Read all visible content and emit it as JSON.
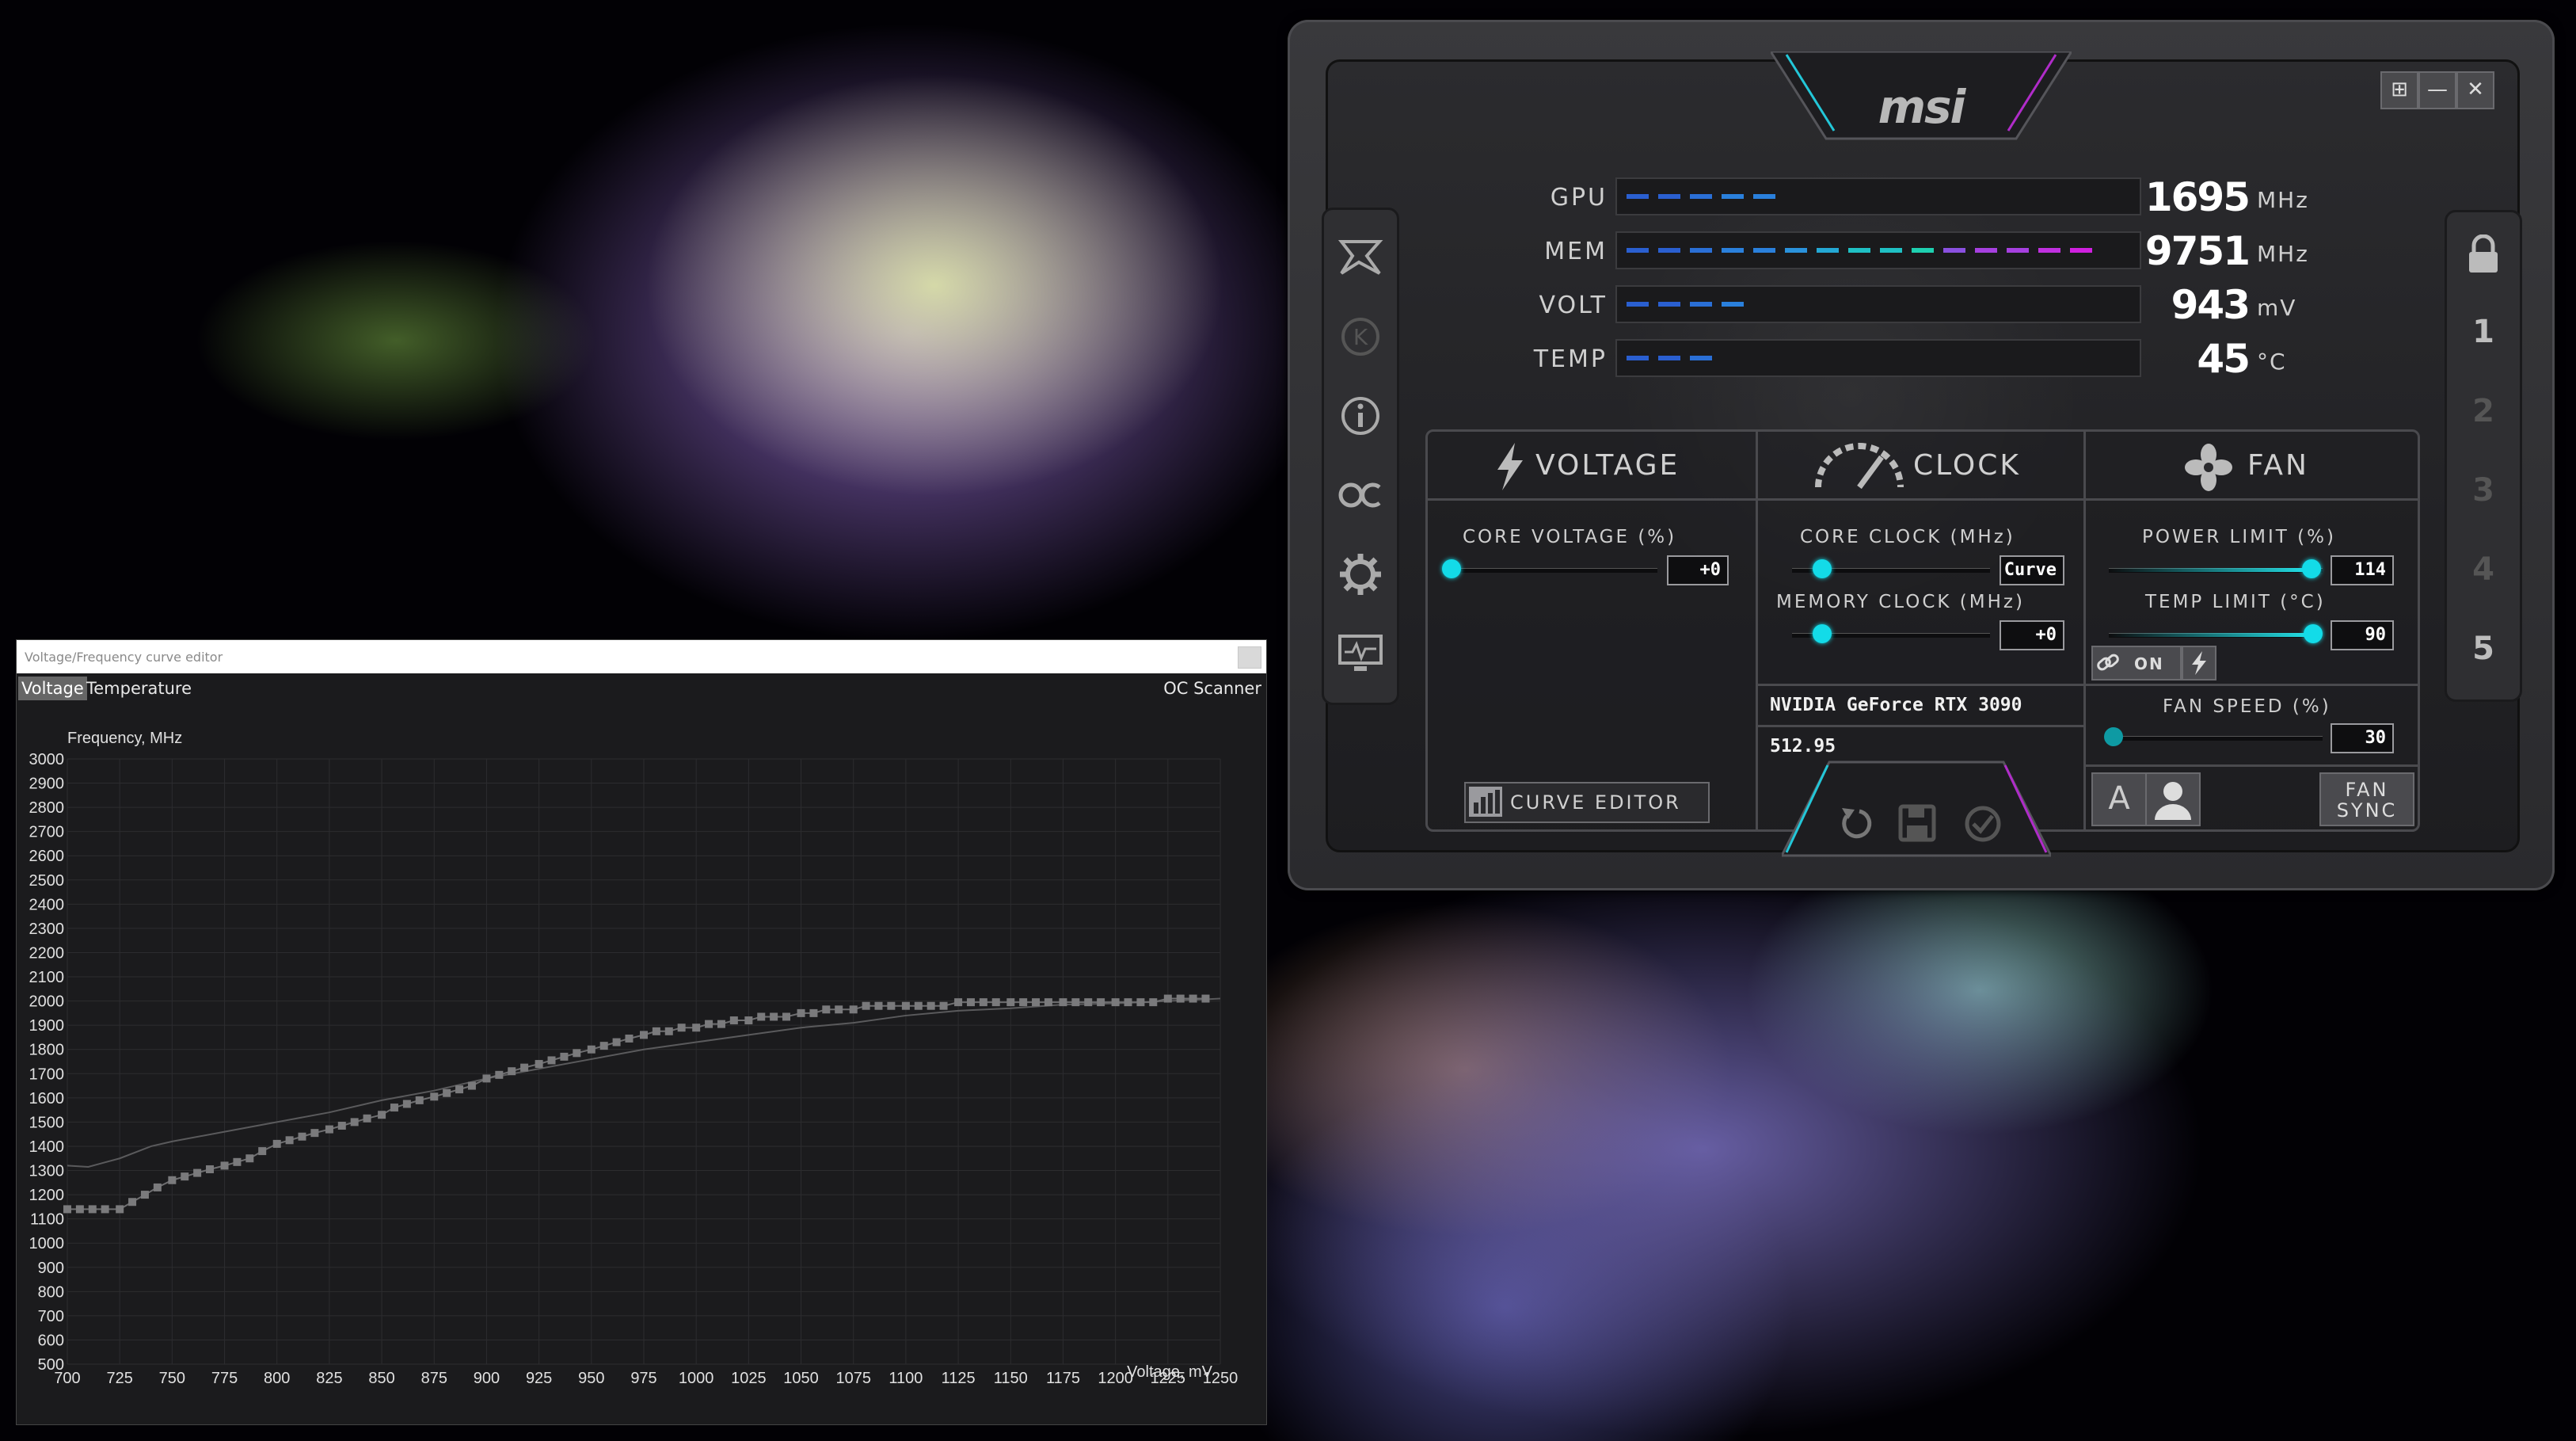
{
  "curve_editor": {
    "title": "Voltage/Frequency curve editor",
    "tabs": [
      "Voltage",
      "Temperature"
    ],
    "oc_scanner_label": "OC Scanner"
  },
  "chart_data": {
    "type": "line",
    "ylabel": "Frequency, MHz",
    "xlabel": "Voltage, mV",
    "xlim": [
      700,
      1250
    ],
    "ylim": [
      500,
      3000
    ],
    "x_ticks": [
      700,
      725,
      750,
      775,
      800,
      825,
      850,
      875,
      900,
      925,
      950,
      975,
      1000,
      1025,
      1050,
      1075,
      1100,
      1125,
      1150,
      1175,
      1200,
      1225,
      1250
    ],
    "y_ticks": [
      500,
      600,
      700,
      800,
      900,
      1000,
      1100,
      1200,
      1300,
      1400,
      1500,
      1600,
      1700,
      1800,
      1900,
      2000,
      2100,
      2200,
      2300,
      2400,
      2500,
      2600,
      2700,
      2800,
      2900,
      3000
    ],
    "grid": true,
    "series": [
      {
        "x": [
          700,
          706,
          712,
          718,
          725,
          731,
          737,
          743,
          750,
          756,
          762,
          768,
          775,
          781,
          787,
          793,
          800,
          806,
          812,
          818,
          825,
          831,
          837,
          843,
          850,
          856,
          862,
          868,
          875,
          881,
          887,
          893,
          900,
          906,
          912,
          918,
          925,
          931,
          937,
          943,
          950,
          956,
          962,
          968,
          975,
          981,
          987,
          993,
          1000,
          1006,
          1012,
          1018,
          1025,
          1031,
          1037,
          1043,
          1050,
          1056,
          1062,
          1068,
          1075,
          1081,
          1087,
          1093,
          1100,
          1106,
          1112,
          1118,
          1125,
          1131,
          1137,
          1143,
          1150,
          1156,
          1162,
          1168,
          1175,
          1181,
          1187,
          1193,
          1200,
          1206,
          1212,
          1218,
          1225,
          1231,
          1237,
          1243
        ],
        "values": [
          1140,
          1140,
          1140,
          1140,
          1140,
          1170,
          1200,
          1230,
          1260,
          1275,
          1290,
          1305,
          1320,
          1335,
          1350,
          1380,
          1410,
          1425,
          1440,
          1455,
          1470,
          1485,
          1500,
          1515,
          1530,
          1560,
          1575,
          1590,
          1605,
          1620,
          1635,
          1650,
          1680,
          1695,
          1710,
          1725,
          1740,
          1755,
          1770,
          1785,
          1800,
          1815,
          1830,
          1845,
          1860,
          1875,
          1875,
          1890,
          1890,
          1905,
          1905,
          1920,
          1920,
          1935,
          1935,
          1935,
          1950,
          1950,
          1965,
          1965,
          1965,
          1980,
          1980,
          1980,
          1980,
          1980,
          1980,
          1980,
          1995,
          1995,
          1995,
          1995,
          1995,
          1995,
          1995,
          1995,
          1995,
          1995,
          1995,
          1995,
          1995,
          1995,
          1995,
          1995,
          2010,
          2010,
          2010,
          2010
        ]
      },
      {
        "x": [
          700,
          710,
          725,
          740,
          750,
          775,
          800,
          825,
          850,
          875,
          900,
          925,
          950,
          975,
          1000,
          1025,
          1050,
          1075,
          1100,
          1125,
          1150,
          1175,
          1200,
          1225,
          1250
        ],
        "values": [
          1320,
          1315,
          1350,
          1400,
          1420,
          1460,
          1500,
          1540,
          1590,
          1630,
          1680,
          1720,
          1760,
          1800,
          1830,
          1860,
          1890,
          1910,
          1940,
          1960,
          1970,
          1985,
          1990,
          2000,
          2010
        ]
      }
    ]
  },
  "msi": {
    "logo": "msi",
    "window_controls": [
      "⊞",
      "—",
      "✕"
    ],
    "meters": [
      {
        "label": "GPU",
        "value": "1695",
        "unit": "MHz",
        "fill": 0.33
      },
      {
        "label": "MEM",
        "value": "9751",
        "unit": "MHz",
        "fill": 1.0
      },
      {
        "label": "VOLT",
        "value": "943",
        "unit": "mV",
        "fill": 0.24
      },
      {
        "label": "TEMP",
        "value": "45",
        "unit": "°C",
        "fill": 0.22
      }
    ],
    "profiles": [
      "1",
      "2",
      "3",
      "4",
      "5"
    ],
    "voltage": {
      "title": "VOLTAGE",
      "core_voltage_label": "CORE VOLTAGE (%)",
      "core_voltage_value": "+0",
      "curve_editor_label": "CURVE EDITOR",
      "core_voltage_level": 0.0
    },
    "clock": {
      "title": "CLOCK",
      "core_clock_label": "CORE CLOCK (MHz)",
      "core_clock_value": "Curve",
      "memory_clock_label": "MEMORY CLOCK (MHz)",
      "memory_clock_value": "+0",
      "gpu_name": "NVIDIA GeForce RTX 3090",
      "driver": "512.95"
    },
    "fan": {
      "title": "FAN",
      "power_limit_label": "POWER LIMIT (%)",
      "power_limit_value": "114",
      "temp_limit_label": "TEMP LIMIT (°C)",
      "temp_limit_value": "90",
      "link_label": "ON",
      "fan_speed_label": "FAN SPEED (%)",
      "fan_speed_value": "30",
      "fan_sync_label_1": "FAN",
      "fan_sync_label_2": "SYNC",
      "auto_label": "A"
    }
  },
  "colors": {
    "accent": "#13dbe8",
    "mem_magenta": "#d020e0",
    "meter_blue": "#2a6fd6"
  }
}
